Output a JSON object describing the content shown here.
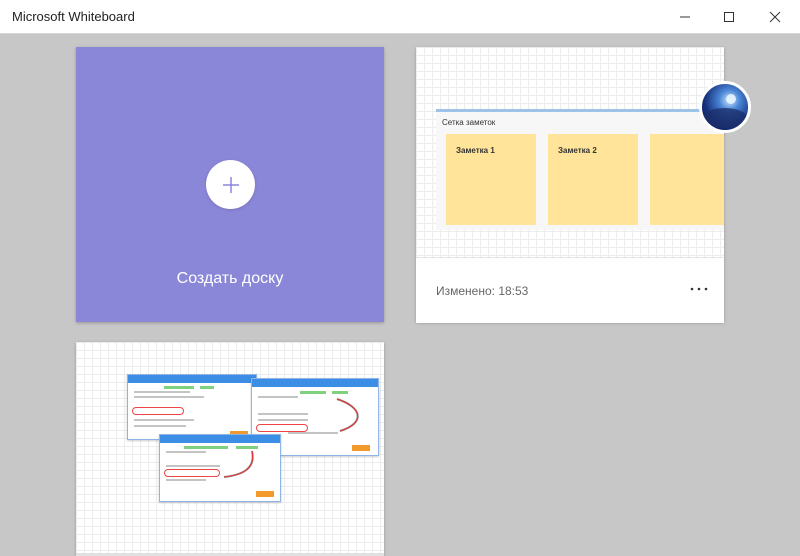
{
  "window": {
    "title": "Microsoft Whiteboard",
    "controls": [
      "minimize-icon",
      "maximize-icon",
      "close-icon"
    ]
  },
  "new_board": {
    "label": "Создать доску",
    "icon": "plus-icon",
    "color": "#8b87d8"
  },
  "boards": [
    {
      "panel_title": "Сетка заметок",
      "notes": [
        "Заметка 1",
        "Заметка 2",
        ""
      ],
      "modified": "Изменено: 18:53",
      "more_icon": "more-dots-icon"
    },
    {
      "thumbnail": "screenshots-thumbnail"
    }
  ]
}
